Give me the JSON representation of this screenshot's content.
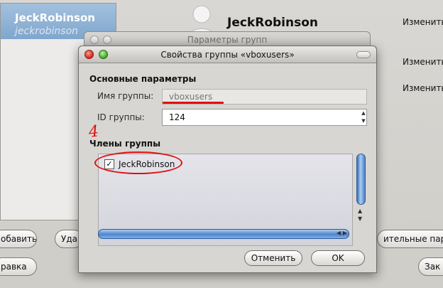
{
  "background": {
    "user_list": {
      "selected_name": "JeckRobinson",
      "selected_login": "jeckrobinson"
    },
    "header_name": "JeckRobinson",
    "change_links": [
      "Изменить",
      "Изменить",
      "Изменить"
    ],
    "buttons": {
      "add": "обавить",
      "delete": "Уда",
      "help": "равка",
      "advanced": "ительные пара",
      "close": "Зак"
    }
  },
  "back_dialog": {
    "title": "Параметры групп"
  },
  "dialog": {
    "title": "Свойства группы «vboxusers»",
    "basic_section": "Основные параметры",
    "group_name_label": "Имя группы:",
    "group_name_value": "vboxusers",
    "group_id_label": "ID группы:",
    "group_id_value": "124",
    "annotation": "4",
    "members_section": "Члены группы",
    "members": [
      {
        "name": "JeckRobinson",
        "checked": true
      }
    ],
    "cancel_label": "Отменить",
    "ok_label": "OK"
  },
  "colors": {
    "annotation_red": "#e01010",
    "scrollbar_blue": "#4f85cc",
    "selection_blue": "#8fb3d7"
  }
}
